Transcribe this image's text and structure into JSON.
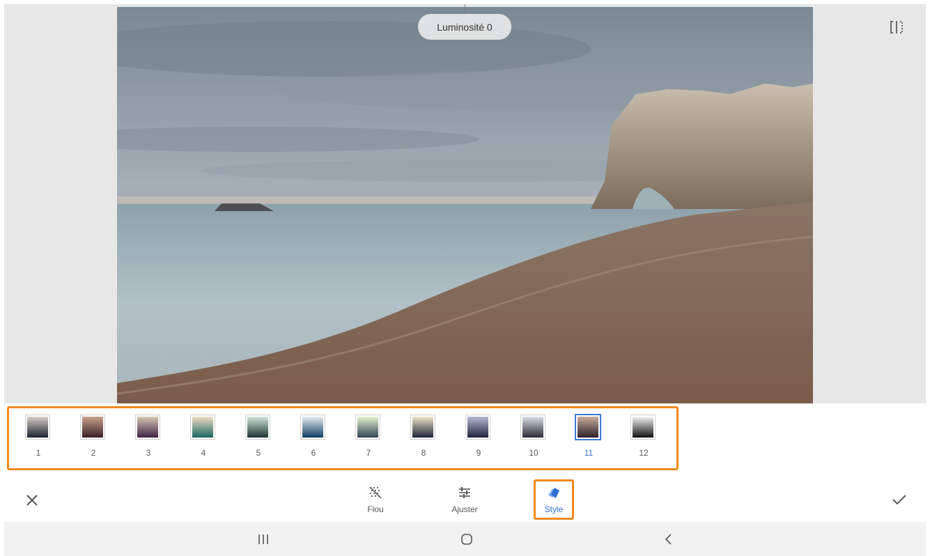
{
  "editor": {
    "indicator_label": "Luminosité 0",
    "compare_icon": "compare-split-icon"
  },
  "styles": {
    "selected_index": 11,
    "items": [
      {
        "label": "1",
        "gradient": [
          "#d9d0c7",
          "#1b2230"
        ]
      },
      {
        "label": "2",
        "gradient": [
          "#c8a28e",
          "#3a1f22"
        ]
      },
      {
        "label": "3",
        "gradient": [
          "#d9c7b5",
          "#3f2346"
        ]
      },
      {
        "label": "4",
        "gradient": [
          "#f2ddc5",
          "#1a6660"
        ]
      },
      {
        "label": "5",
        "gradient": [
          "#d2e6dc",
          "#1e3431"
        ]
      },
      {
        "label": "6",
        "gradient": [
          "#e6edf0",
          "#0d3f63"
        ]
      },
      {
        "label": "7",
        "gradient": [
          "#e6f2cd",
          "#314456"
        ]
      },
      {
        "label": "8",
        "gradient": [
          "#f0e4c8",
          "#1d2538"
        ]
      },
      {
        "label": "9",
        "gradient": [
          "#b5bad3",
          "#21233d"
        ]
      },
      {
        "label": "10",
        "gradient": [
          "#d9dde6",
          "#2d2a39"
        ]
      },
      {
        "label": "11",
        "gradient": [
          "#c9ad9c",
          "#2e1f29"
        ]
      },
      {
        "label": "12",
        "gradient": [
          "#f4f4f4",
          "#111111"
        ]
      }
    ]
  },
  "toolbar": {
    "cancel_icon": "close-icon",
    "confirm_icon": "check-icon",
    "tools": [
      {
        "label": "Flou",
        "icon": "blur-icon"
      },
      {
        "label": "Ajuster",
        "icon": "sliders-icon"
      },
      {
        "label": "Style",
        "icon": "style-icon",
        "active": true
      }
    ]
  },
  "navbar": {
    "icons": [
      "recent-apps-icon",
      "home-icon",
      "back-icon"
    ]
  },
  "colors": {
    "accent": "#2f6fd0",
    "highlight": "#f08a1c"
  }
}
